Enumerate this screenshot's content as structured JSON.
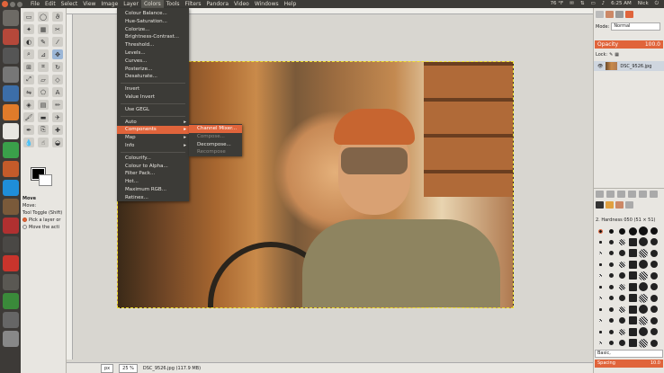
{
  "menubar": {
    "items": [
      "File",
      "Edit",
      "Select",
      "View",
      "Image",
      "Layer",
      "Colors",
      "Tools",
      "Filters",
      "Pandora",
      "Video",
      "Windows",
      "Help"
    ],
    "active": "Colors",
    "tray": {
      "temp": "76 °F",
      "time": "6:25 AM",
      "user": "Nick"
    }
  },
  "colors_menu": {
    "group1": [
      "Colour Balance...",
      "Hue-Saturation...",
      "Colorize...",
      "Brightness-Contrast...",
      "Threshold...",
      "Levels...",
      "Curves...",
      "Posterize...",
      "Desaturate..."
    ],
    "group2": [
      "Invert",
      "Value Invert"
    ],
    "group3": [
      "Use GEGL"
    ],
    "group4": [
      {
        "label": "Auto",
        "submenu": true
      },
      {
        "label": "Components",
        "submenu": true,
        "highlighted": true
      },
      {
        "label": "Map",
        "submenu": true
      },
      {
        "label": "Info",
        "submenu": true
      }
    ],
    "group5": [
      "Colourify...",
      "Colour to Alpha...",
      "Filter Pack...",
      "Hot...",
      "Maximum RGB...",
      "Retinex..."
    ]
  },
  "components_submenu": [
    {
      "label": "Channel Mixer...",
      "state": "highlighted"
    },
    {
      "label": "Compose...",
      "state": "disabled"
    },
    {
      "label": "Decompose...",
      "state": "normal"
    },
    {
      "label": "Recompose",
      "state": "disabled"
    }
  ],
  "toolbox": {
    "tool_name": "Move",
    "move_label": "Move:",
    "tool_toggle": "Tool Toggle (Shift)",
    "option1": "Pick a layer or",
    "option2": "Move the acti"
  },
  "status": {
    "unit": "px",
    "zoom": "25 %",
    "file": "DSC_9526.jpg (117.9 MB)"
  },
  "dock": {
    "mode_label": "Mode:",
    "mode_value": "Normal",
    "opacity_label": "Opacity",
    "opacity_value": "100.0",
    "lock_label": "Lock:",
    "layer_name": "DSC_9526.jpg",
    "brush_name": "2. Hardness 050 (51 × 51)",
    "brush_tag": "Basic,",
    "spacing_label": "Spacing",
    "spacing_value": "10.0"
  },
  "colors": {
    "accent": "#e0643b",
    "menu_bg": "#3c3b37",
    "panel_bg": "#e8e6e1"
  }
}
